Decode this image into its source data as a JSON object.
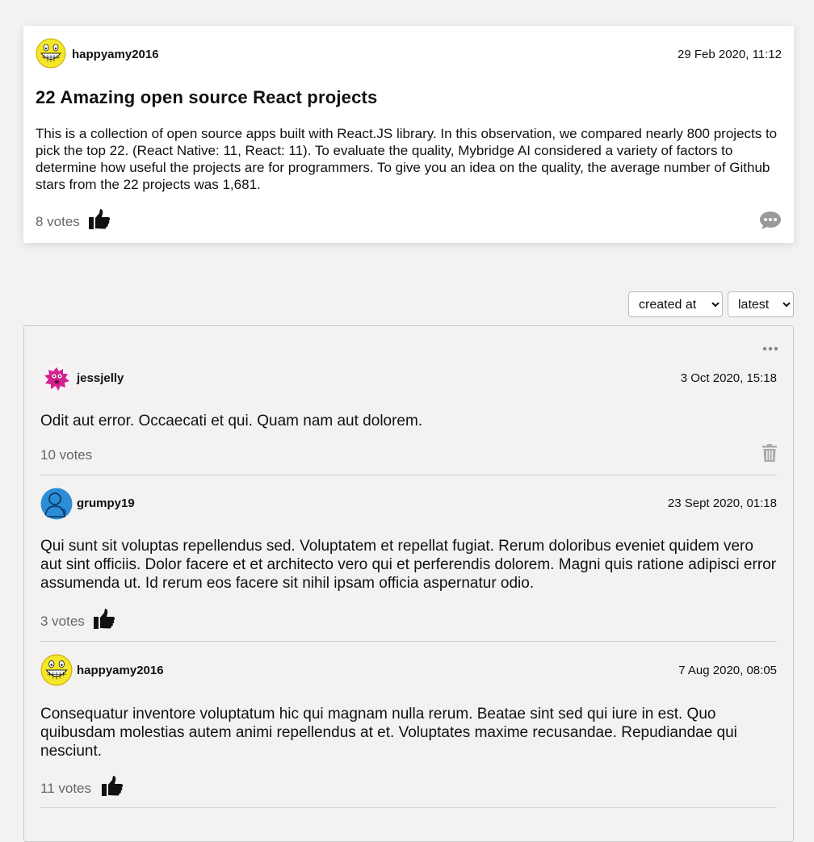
{
  "post": {
    "author": "happyamy2016",
    "date": "29 Feb 2020, 11:12",
    "title": "22 Amazing open source React projects",
    "body": "This is a collection of open source apps built with React.JS library. In this observation, we compared nearly 800 projects to pick the top 22. (React Native: 11, React: 11). To evaluate the quality, Mybridge AI considered a variety of factors to determine how useful the projects are for programmers. To give you an idea on the quality, the average number of Github stars from the 22 projects was 1,681.",
    "votes": "8 votes",
    "avatar_icon": "smiley-avatar-icon",
    "like_icon": "thumbs-up-icon",
    "comment_icon": "comment-bubble-icon"
  },
  "sort": {
    "field_options": [
      "created at"
    ],
    "field_value": "created at",
    "order_options": [
      "latest"
    ],
    "order_value": "latest"
  },
  "comments": [
    {
      "author": "jessjelly",
      "date": "3 Oct 2020, 15:18",
      "text": "Odit aut error. Occaecati et qui. Quam nam aut dolorem.",
      "votes": "10 votes",
      "action_icon": "trash-icon",
      "avatar_icon": "pink-blob-avatar-icon"
    },
    {
      "author": "grumpy19",
      "date": "23 Sept 2020, 01:18",
      "text": "Qui sunt sit voluptas repellendus sed. Voluptatem et repellat fugiat. Rerum doloribus eveniet quidem vero aut sint officiis. Dolor facere et et architecto vero qui et perferendis dolorem. Magni quis ratione adipisci error assumenda ut. Id rerum eos facere sit nihil ipsam officia aspernatur odio.",
      "votes": "3 votes",
      "action_icon": "thumbs-up-icon",
      "avatar_icon": "blue-person-avatar-icon"
    },
    {
      "author": "happyamy2016",
      "date": "7 Aug 2020, 08:05",
      "text": "Consequatur inventore voluptatum hic qui magnam nulla rerum. Beatae sint sed qui iure in est. Quo quibusdam molestias autem animi repellendus at et. Voluptates maxime recusandae. Repudiandae qui nesciunt.",
      "votes": "11 votes",
      "action_icon": "thumbs-up-icon",
      "avatar_icon": "smiley-avatar-icon"
    }
  ],
  "colors": {
    "background": "#f3f2f1",
    "card": "#ffffff",
    "muted_text": "#666666",
    "icon_gray": "#aaaaaa"
  }
}
